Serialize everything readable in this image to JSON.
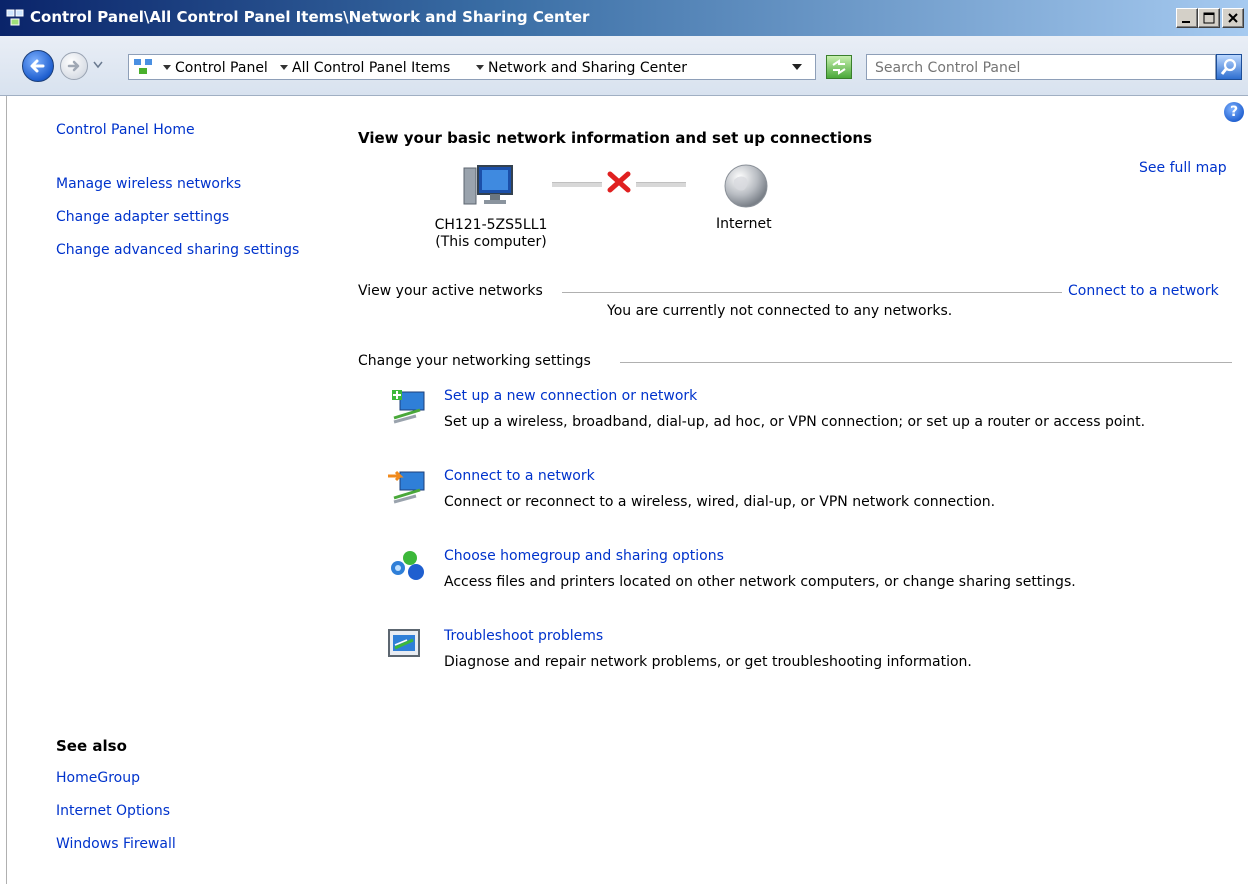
{
  "window": {
    "title": "Control Panel\\All Control Panel Items\\Network and Sharing Center"
  },
  "address_bar": {
    "breadcrumbs": [
      "Control Panel",
      "All Control Panel Items",
      "Network and Sharing Center"
    ],
    "search_placeholder": "Search Control Panel"
  },
  "sidebar": {
    "home": "Control Panel Home",
    "links": [
      "Manage wireless networks",
      "Change adapter settings",
      "Change advanced sharing settings"
    ],
    "see_also_title": "See also",
    "see_also": [
      "HomeGroup",
      "Internet Options",
      "Windows Firewall"
    ]
  },
  "main": {
    "heading": "View your basic network information and set up connections",
    "see_full_map": "See full map",
    "map": {
      "computer_name": "CH121-5ZS5LL1",
      "computer_sub": "(This computer)",
      "internet": "Internet"
    },
    "active_networks": {
      "label": "View your active networks",
      "connect_link": "Connect to a network",
      "status": "You are currently not connected to any networks."
    },
    "settings": {
      "label": "Change your networking settings",
      "tasks": [
        {
          "title": "Set up a new connection or network",
          "description": "Set up a wireless, broadband, dial-up, ad hoc, or VPN connection; or set up a router or access point."
        },
        {
          "title": "Connect to a network",
          "description": "Connect or reconnect to a wireless, wired, dial-up, or VPN network connection."
        },
        {
          "title": "Choose homegroup and sharing options",
          "description": "Access files and printers located on other network computers, or change sharing settings."
        },
        {
          "title": "Troubleshoot problems",
          "description": "Diagnose and repair network problems, or get troubleshooting information."
        }
      ]
    }
  },
  "icons": {
    "title": "network-center-icon",
    "back": "back-arrow-icon",
    "forward": "forward-arrow-icon",
    "refresh": "refresh-icon",
    "search": "search-icon",
    "help": "help-icon",
    "computer": "computer-icon",
    "disconnected": "red-x-icon",
    "internet": "globe-icon"
  },
  "colors": {
    "link": "#0033cc",
    "title_bar_start": "#0a246a",
    "title_bar_end": "#a6caf0",
    "error_x": "#e02020"
  }
}
